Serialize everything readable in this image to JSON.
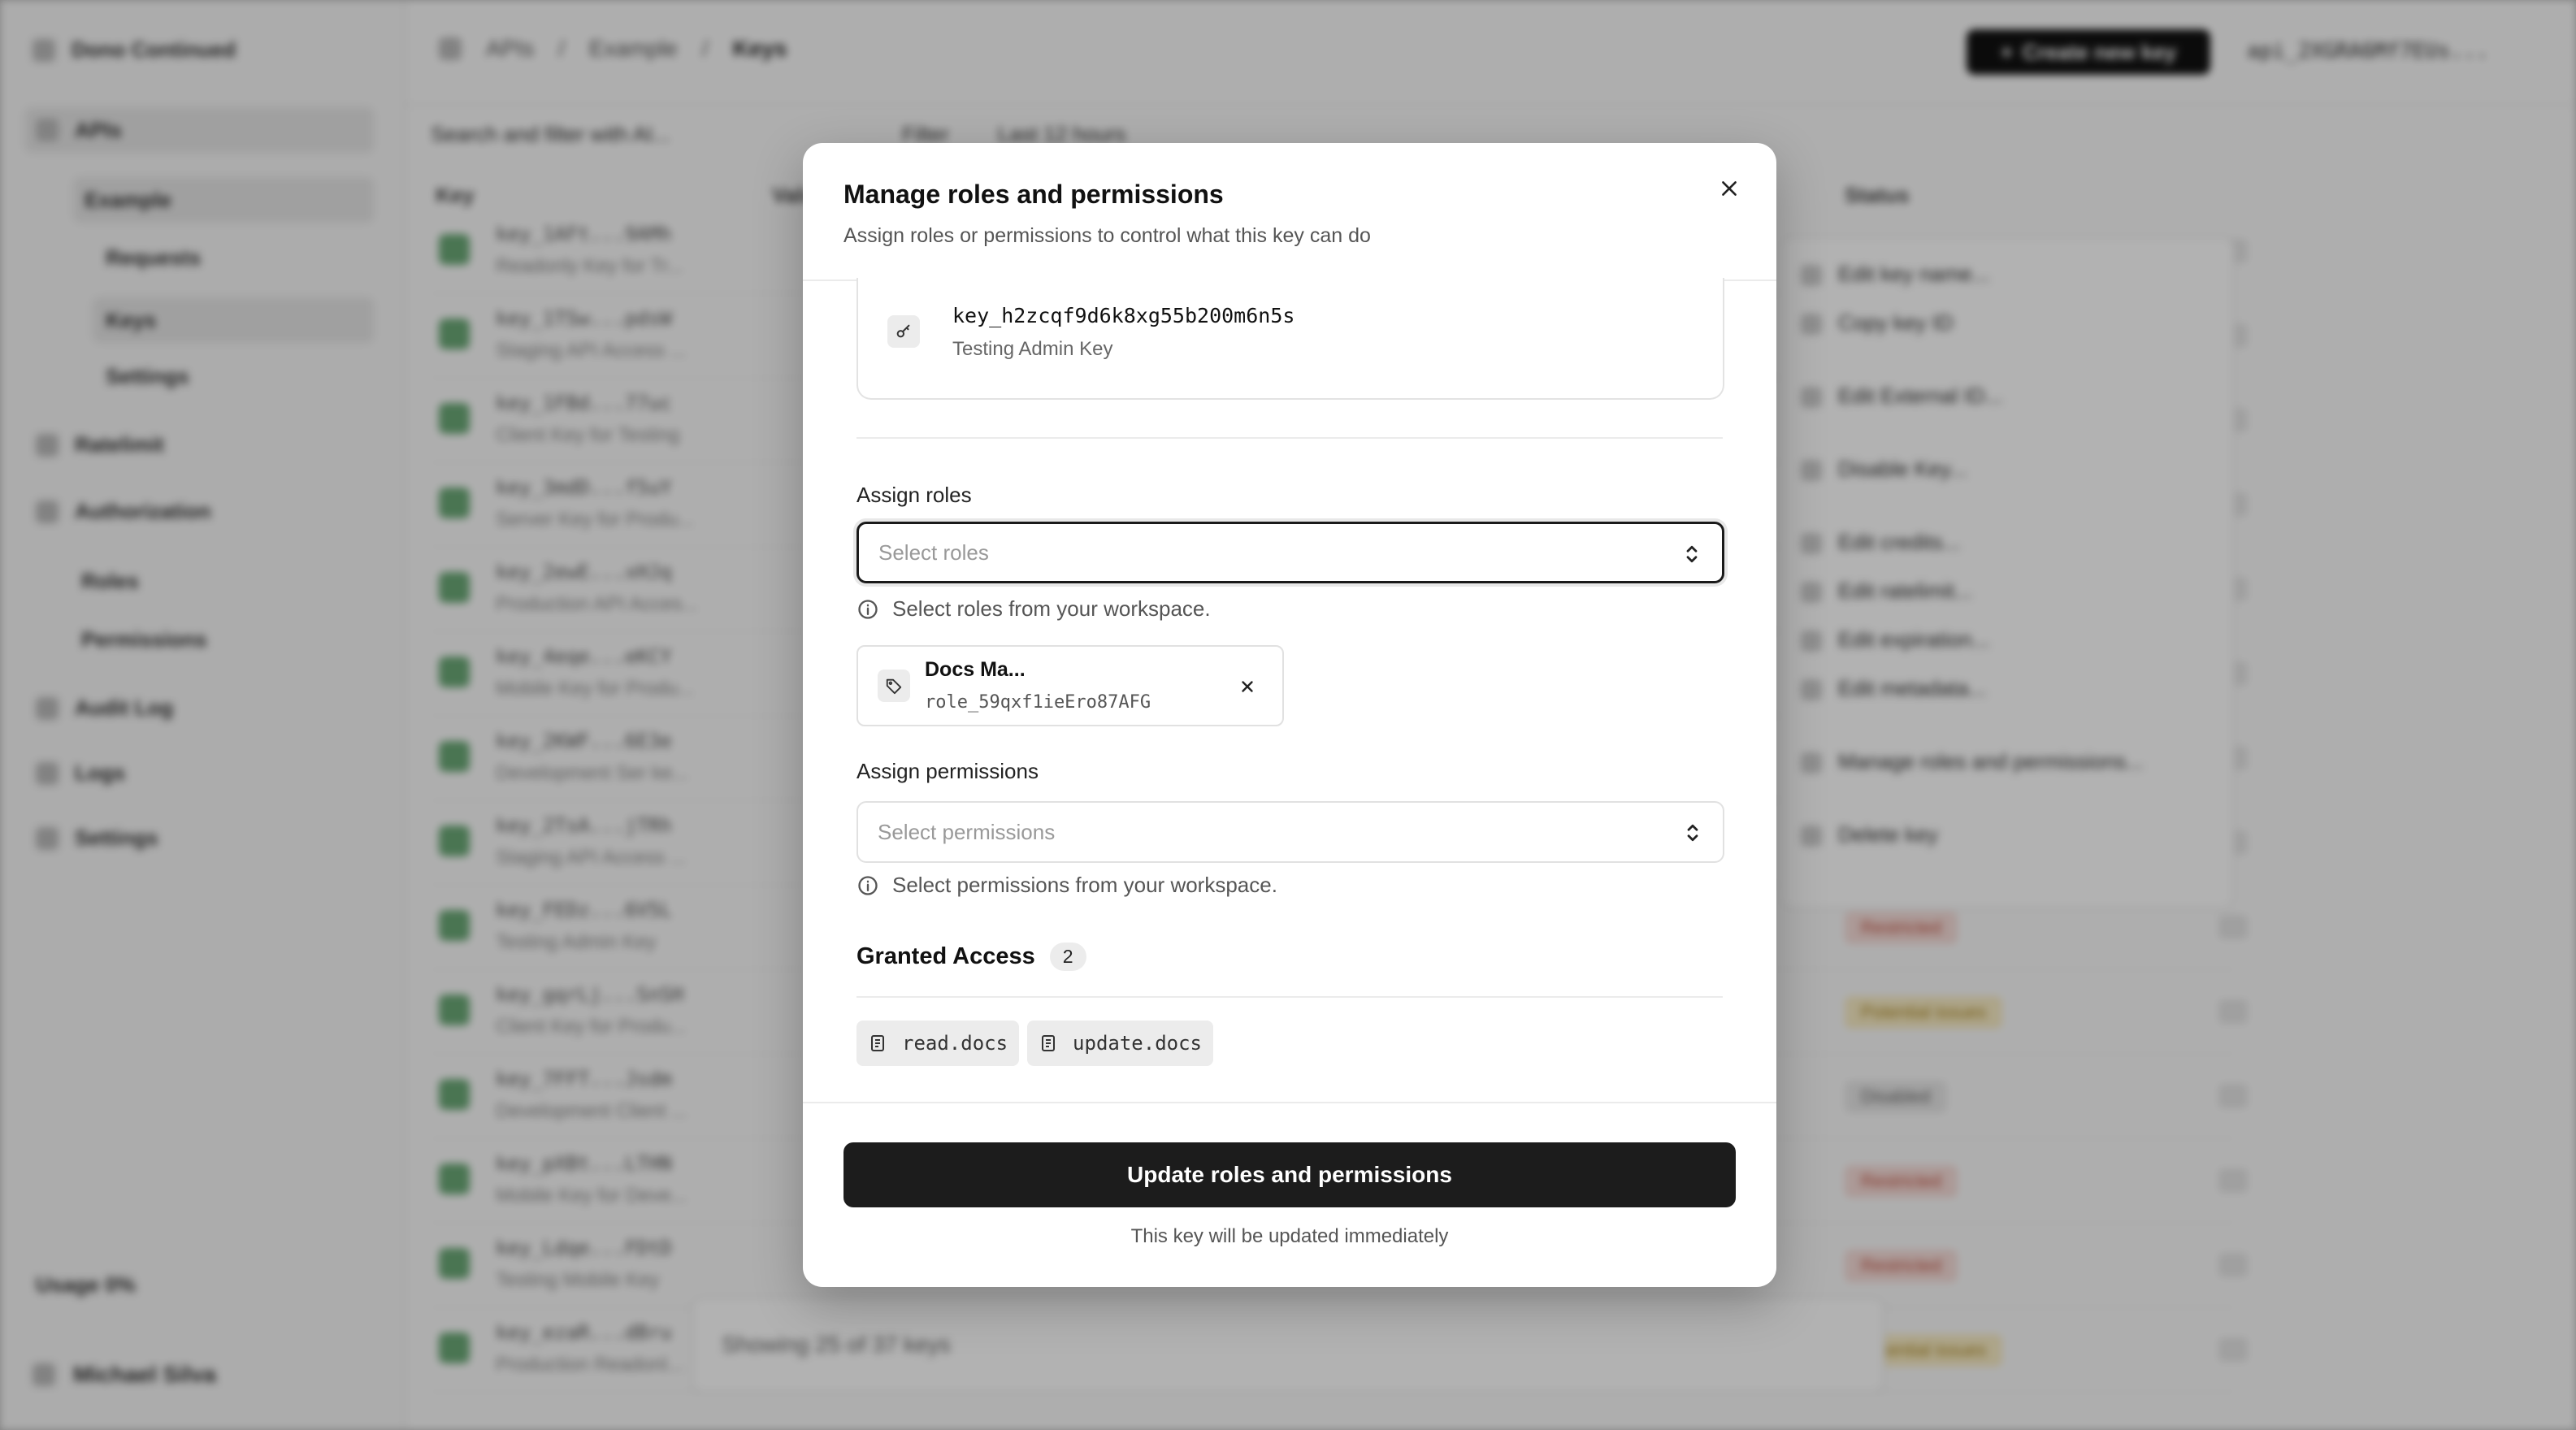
{
  "background": {
    "sidebar": {
      "workspace": "Dono Continued",
      "items": [
        "APIs",
        "Example",
        "Requests",
        "Keys",
        "Settings",
        "Ratelimit",
        "Authorization",
        "Roles",
        "Permissions",
        "Audit Log",
        "Logs",
        "Settings"
      ],
      "usage": "Usage 0%",
      "user": "Michael Silva"
    },
    "topbar": {
      "breadcrumbs": [
        "APIs",
        "/",
        "Example",
        "/",
        "Keys"
      ],
      "create_button": "Create new key",
      "api_id": "api_2XGRA6Mf7EUs..."
    },
    "filters": [
      "Search and filter with AI...",
      "Filter",
      "Last 12 hours"
    ],
    "columns": [
      "Key",
      "Value",
      "Status"
    ],
    "rows": [
      {
        "id": "key_1AFt...9AMh",
        "name": "Readonly Key for Tr...",
        "status": ""
      },
      {
        "id": "key_1TSw...pdsW",
        "name": "Staging API Access ...",
        "status": ""
      },
      {
        "id": "key_1FBd...77uc",
        "name": "Client Key for Testing",
        "status": ""
      },
      {
        "id": "key_3mdD...f5uY",
        "name": "Server Key for Produ...",
        "status": ""
      },
      {
        "id": "key_2ewE...xHJq",
        "name": "Production API Acces...",
        "status": ""
      },
      {
        "id": "key_4eqe...eKCY",
        "name": "Mobile Key for Produ...",
        "status": ""
      },
      {
        "id": "key_2KWF...6E3e",
        "name": "Development Ser ke...",
        "status": ""
      },
      {
        "id": "key_2TsA...jTRh",
        "name": "Staging API Access ...",
        "status": ""
      },
      {
        "id": "key_FEDz...6V5L",
        "name": "Testing Admin Key",
        "status": "Restricted"
      },
      {
        "id": "key_gqrLj...SnSH",
        "name": "Client Key for Produ...",
        "status": "Potential issues"
      },
      {
        "id": "key_7FFT...Jsdm",
        "name": "Development Client ...",
        "status": "Disabled"
      },
      {
        "id": "key_pXBt...LTHN",
        "name": "Mobile Key for Deve...",
        "status": "Restricted"
      },
      {
        "id": "key_Ldqe...FDtD",
        "name": "Testing Mobile Key",
        "status": "Restricted"
      },
      {
        "id": "key_ezaR...dBru",
        "name": "Production Readonl...",
        "status": "Potential issues"
      }
    ],
    "menu": [
      "Edit key name...",
      "Copy key ID",
      "Edit External ID...",
      "Disable Key...",
      "Edit credits...",
      "Edit ratelimit...",
      "Edit expiration...",
      "Edit metadata...",
      "Manage roles and permissions...",
      "Delete key"
    ],
    "pager": "Showing 25 of 37 keys"
  },
  "modal": {
    "title": "Manage roles and permissions",
    "subtitle": "Assign roles or permissions to control what this key can do",
    "key": {
      "id": "key_h2zcqf9d6k8xg55b200m6n5s",
      "name": "Testing Admin Key"
    },
    "roles": {
      "label": "Assign roles",
      "placeholder": "Select roles",
      "hint": "Select roles from your workspace.",
      "selected": [
        {
          "name": "Docs Ma...",
          "id": "role_59qxf1ieEro87AFG"
        }
      ]
    },
    "permissions": {
      "label": "Assign permissions",
      "placeholder": "Select permissions",
      "hint": "Select permissions from your workspace."
    },
    "granted": {
      "title": "Granted Access",
      "count": "2",
      "items": [
        "read.docs",
        "update.docs"
      ]
    },
    "submit_label": "Update roles and permissions",
    "footnote": "This key will be updated immediately"
  },
  "colors": {
    "primary_button": "#1c1c1c",
    "restricted": "#e36a5a",
    "potential_issues": "#e8b93a",
    "ok_icon": "#6aa876"
  }
}
